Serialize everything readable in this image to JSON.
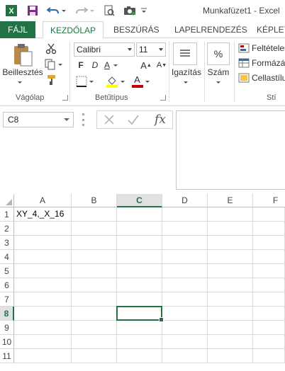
{
  "window": {
    "title": "Munkafüzet1 - Excel"
  },
  "tabs": [
    {
      "label": "FÁJL"
    },
    {
      "label": "KEZDŐLAP"
    },
    {
      "label": "BESZÚRÁS"
    },
    {
      "label": "LAPELRENDEZÉS"
    },
    {
      "label": "KÉPLET"
    }
  ],
  "ribbon": {
    "clipboard": {
      "paste_label": "Beillesztés",
      "group_label": "Vágólap"
    },
    "font": {
      "name": "Calibri",
      "size": "11",
      "bold": "F",
      "italic": "D",
      "underline": "A",
      "grow": "A",
      "shrink": "A",
      "font_color_glyph": "A",
      "group_label": "Betűtípus"
    },
    "alignment": {
      "label": "Igazítás"
    },
    "number": {
      "label": "Szám",
      "symbol": "%"
    },
    "styles": {
      "items": [
        "Feltételes",
        "Formázá",
        "Cellastílu"
      ],
      "group_label": "Stí"
    }
  },
  "formula_bar": {
    "name_box": "C8",
    "fx": "fx",
    "value": ""
  },
  "grid": {
    "columns": [
      "A",
      "B",
      "C",
      "D",
      "E",
      "F"
    ],
    "selected_column": "C",
    "rows": [
      "1",
      "2",
      "3",
      "4",
      "5",
      "6",
      "7",
      "8",
      "9",
      "10",
      "11"
    ],
    "selected_row": "8",
    "active_cell": "C8",
    "cells": {
      "A1": "XY_4,_X_16"
    }
  },
  "colors": {
    "accent": "#217346",
    "fill_highlight": "#ffff00",
    "font_color": "#c00000"
  }
}
